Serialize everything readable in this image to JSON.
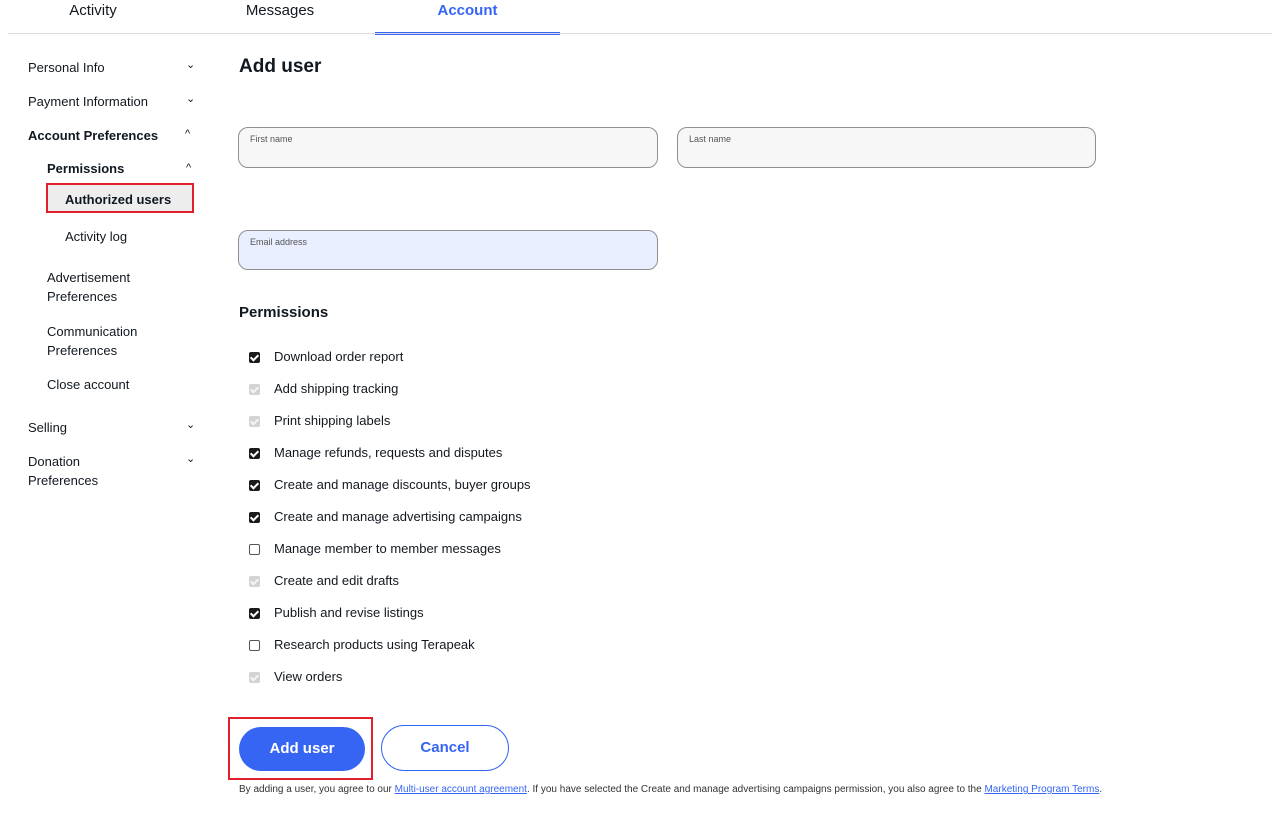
{
  "tabs": {
    "activity": "Activity",
    "messages": "Messages",
    "account": "Account"
  },
  "sidebar": {
    "personal_info": "Personal Info",
    "payment_information": "Payment Information",
    "account_preferences": "Account Preferences",
    "permissions": "Permissions",
    "authorized_users": "Authorized users",
    "activity_log": "Activity log",
    "advertisement_1": "Advertisement",
    "advertisement_2": "Preferences",
    "communication_1": "Communication",
    "communication_2": "Preferences",
    "close_account": "Close account",
    "selling": "Selling",
    "donation_1": "Donation",
    "donation_2": "Preferences",
    "chevron_down": "⌄",
    "chevron_up": "^"
  },
  "main": {
    "title": "Add user",
    "first_name_label": "First name",
    "last_name_label": "Last name",
    "email_label": "Email address",
    "permissions_title": "Permissions",
    "permissions": [
      {
        "label": "Download order report",
        "state": "checked"
      },
      {
        "label": "Add shipping tracking",
        "state": "disabled-checked"
      },
      {
        "label": "Print shipping labels",
        "state": "disabled-checked"
      },
      {
        "label": "Manage refunds, requests and disputes",
        "state": "checked"
      },
      {
        "label": "Create and manage discounts, buyer groups",
        "state": "checked"
      },
      {
        "label": "Create and manage advertising campaigns",
        "state": "checked"
      },
      {
        "label": "Manage member to member messages",
        "state": "unchecked"
      },
      {
        "label": "Create and edit drafts",
        "state": "disabled-checked"
      },
      {
        "label": "Publish and revise listings",
        "state": "checked"
      },
      {
        "label": "Research products using Terapeak",
        "state": "unchecked"
      },
      {
        "label": "View orders",
        "state": "disabled-checked"
      }
    ],
    "add_user_button": "Add user",
    "cancel_button": "Cancel",
    "legal_1": "By adding a user, you agree to our ",
    "legal_link_1": "Multi-user account agreement",
    "legal_2": ". If you have selected the Create and manage advertising campaigns permission, you also agree to the ",
    "legal_link_2": "Marketing Program Terms",
    "legal_3": "."
  },
  "colors": {
    "accent": "#3665f3",
    "highlight_box": "#e0202a"
  }
}
